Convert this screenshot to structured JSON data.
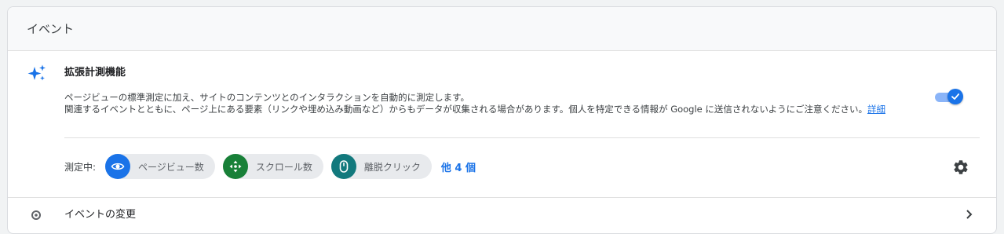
{
  "header": {
    "title": "イベント"
  },
  "enhanced_measurement": {
    "title": "拡張計測機能",
    "description_line1": "ページビューの標準測定に加え、サイトのコンテンツとのインタラクションを自動的に測定します。",
    "description_line2": "関連するイベントとともに、ページ上にある要素（リンクや埋め込み動画など）からもデータが収集される場合があります。個人を特定できる情報が Google に送信されないようにご注意ください。",
    "details_link": "詳細",
    "toggle_state": "on",
    "measuring_label": "測定中:",
    "chips": [
      {
        "label": "ページビュー数",
        "icon": "eye-icon",
        "color": "#1a73e8"
      },
      {
        "label": "スクロール数",
        "icon": "scroll-arrows-icon",
        "color": "#188038"
      },
      {
        "label": "離脱クリック",
        "icon": "mouse-icon",
        "color": "#12797d"
      }
    ],
    "more_link": "他 4 個"
  },
  "modify_events": {
    "title": "イベントの変更"
  },
  "colors": {
    "accent": "#1a73e8",
    "toggle_track": "#8ab4f8"
  }
}
